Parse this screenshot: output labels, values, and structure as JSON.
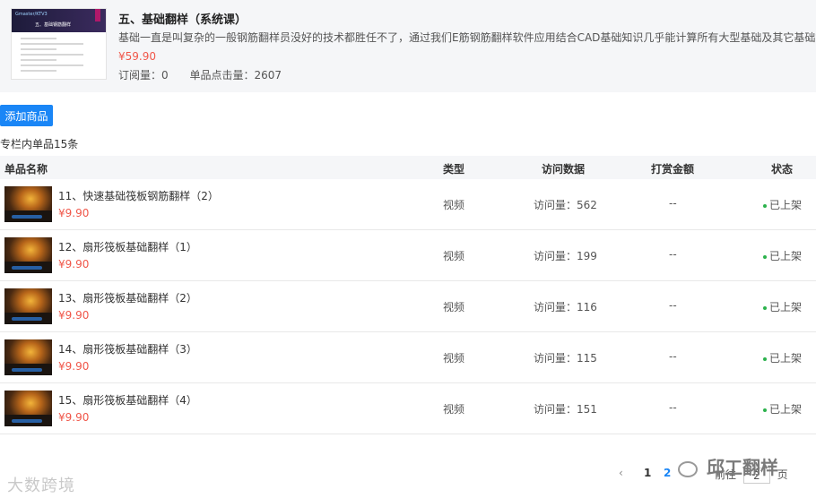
{
  "course": {
    "cover_tag": "Gmaster/KTV3",
    "cover_title": "五、基础钢筋翻样",
    "title": "五、基础翻样（系统课）",
    "description": "基础一直是叫复杂的一般钢筋翻样员没好的技术都胜任不了，通过我们E筋钢筋翻样软件应用结合CAD基础知识几乎能计算所有大型基础及其它基础钢",
    "price": "¥59.90",
    "subscriptions": "订阅量：0",
    "clicks": "单品点击量：2607"
  },
  "toolbar": {
    "add_label": "添加商品"
  },
  "list": {
    "count_text": "专栏内单品15条"
  },
  "table": {
    "headers": {
      "name": "单品名称",
      "type": "类型",
      "visits": "访问数据",
      "tips": "打赏金额",
      "status": "状态"
    },
    "rows": [
      {
        "title": "11、快速基础筏板钢筋翻样（2）",
        "price": "¥9.90",
        "type": "视频",
        "visits": "访问量：562",
        "tips": "--",
        "status": "已上架"
      },
      {
        "title": "12、扇形筏板基础翻样（1）",
        "price": "¥9.90",
        "type": "视频",
        "visits": "访问量：199",
        "tips": "--",
        "status": "已上架"
      },
      {
        "title": "13、扇形筏板基础翻样（2）",
        "price": "¥9.90",
        "type": "视频",
        "visits": "访问量：116",
        "tips": "--",
        "status": "已上架"
      },
      {
        "title": "14、扇形筏板基础翻样（3）",
        "price": "¥9.90",
        "type": "视频",
        "visits": "访问量：115",
        "tips": "--",
        "status": "已上架"
      },
      {
        "title": "15、扇形筏板基础翻样（4）",
        "price": "¥9.90",
        "type": "视频",
        "visits": "访问量：151",
        "tips": "--",
        "status": "已上架"
      }
    ]
  },
  "pagination": {
    "prev": "‹",
    "page1": "1",
    "page2": "2",
    "goto_prefix": "前往",
    "goto_value": "2",
    "goto_suffix": "页"
  },
  "watermarks": {
    "left": "大数跨境",
    "right": "邱工翻样"
  },
  "colors": {
    "accent": "#1a86f6",
    "price": "#f0574a",
    "status_dot": "#2bb24c"
  }
}
